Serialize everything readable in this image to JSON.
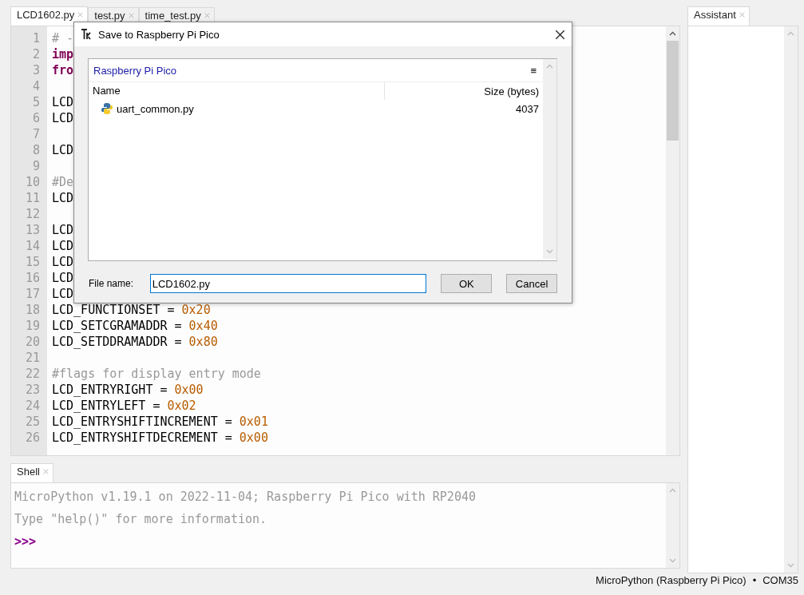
{
  "editor_tabs": [
    {
      "label": "LCD1602.py",
      "selected": true
    },
    {
      "label": "test.py",
      "selected": false
    },
    {
      "label": "time_test.py",
      "selected": false
    }
  ],
  "editor": {
    "lines": [
      {
        "number": "1",
        "tokens": [
          {
            "kind": "comment",
            "text": "# -"
          }
        ]
      },
      {
        "number": "2",
        "tokens": [
          {
            "kind": "keyword",
            "text": "imp"
          }
        ]
      },
      {
        "number": "3",
        "tokens": [
          {
            "kind": "keyword",
            "text": "fro"
          }
        ]
      },
      {
        "number": "4"
      },
      {
        "number": "5",
        "tokens": [
          {
            "kind": "name",
            "text": "LCD"
          }
        ]
      },
      {
        "number": "6",
        "tokens": [
          {
            "kind": "name",
            "text": "LCD"
          }
        ]
      },
      {
        "number": "7"
      },
      {
        "number": "8",
        "tokens": [
          {
            "kind": "name",
            "text": "LCD"
          }
        ]
      },
      {
        "number": "9"
      },
      {
        "number": "10",
        "tokens": [
          {
            "kind": "comment",
            "text": "#De"
          }
        ]
      },
      {
        "number": "11",
        "tokens": [
          {
            "kind": "name",
            "text": "LCD"
          }
        ]
      },
      {
        "number": "12"
      },
      {
        "number": "13",
        "tokens": [
          {
            "kind": "name",
            "text": "LCD"
          }
        ]
      },
      {
        "number": "14",
        "tokens": [
          {
            "kind": "name",
            "text": "LCD"
          }
        ]
      },
      {
        "number": "15",
        "tokens": [
          {
            "kind": "name",
            "text": "LCD"
          }
        ]
      },
      {
        "number": "16",
        "tokens": [
          {
            "kind": "name",
            "text": "LCD"
          }
        ]
      },
      {
        "number": "17",
        "tokens": [
          {
            "kind": "name",
            "text": "LCD"
          }
        ]
      },
      {
        "number": "18",
        "tokens": [
          {
            "kind": "name",
            "text": "LCD_FUNCTIONSET = "
          },
          {
            "kind": "number",
            "text": "0x20"
          }
        ]
      },
      {
        "number": "19",
        "tokens": [
          {
            "kind": "name",
            "text": "LCD_SETCGRAMADDR = "
          },
          {
            "kind": "number",
            "text": "0x40"
          }
        ]
      },
      {
        "number": "20",
        "tokens": [
          {
            "kind": "name",
            "text": "LCD_SETDDRAMADDR = "
          },
          {
            "kind": "number",
            "text": "0x80"
          }
        ]
      },
      {
        "number": "21"
      },
      {
        "number": "22",
        "tokens": [
          {
            "kind": "comment",
            "text": "#flags for display entry mode"
          }
        ]
      },
      {
        "number": "23",
        "tokens": [
          {
            "kind": "name",
            "text": "LCD_ENTRYRIGHT = "
          },
          {
            "kind": "number",
            "text": "0x00"
          }
        ]
      },
      {
        "number": "24",
        "tokens": [
          {
            "kind": "name",
            "text": "LCD_ENTRYLEFT = "
          },
          {
            "kind": "number",
            "text": "0x02"
          }
        ]
      },
      {
        "number": "25",
        "tokens": [
          {
            "kind": "name",
            "text": "LCD_ENTRYSHIFTINCREMENT = "
          },
          {
            "kind": "number",
            "text": "0x01"
          }
        ]
      },
      {
        "number": "26",
        "tokens": [
          {
            "kind": "name",
            "text": "LCD_ENTRYSHIFTDECREMENT = "
          },
          {
            "kind": "number",
            "text": "0x00"
          }
        ]
      }
    ]
  },
  "shell_tabs": [
    {
      "label": "Shell",
      "selected": true
    }
  ],
  "shell": {
    "lines": [
      {
        "kind": "output",
        "text": "MicroPython v1.19.1 on 2022-11-04; Raspberry Pi Pico with RP2040"
      },
      {
        "kind": "output",
        "text": "Type \"help()\" for more information."
      },
      {
        "kind": "prompt",
        "text": ">>>"
      }
    ]
  },
  "assistant_tabs": [
    {
      "label": "Assistant",
      "selected": true
    }
  ],
  "status_bar": {
    "interpreter": "MicroPython (Raspberry Pi Pico)",
    "separator": "•",
    "port": "COM35"
  },
  "dialog": {
    "title": "Save to Raspberry Pi Pico",
    "location": "Raspberry Pi Pico",
    "menu_glyph": "≡",
    "columns": [
      "Name",
      "Size (bytes)"
    ],
    "files": [
      {
        "name": "uart_common.py",
        "size": "4037"
      }
    ],
    "file_name_label": "File name:",
    "file_name": "LCD1602.py",
    "buttons": [
      "OK",
      "Cancel"
    ]
  }
}
